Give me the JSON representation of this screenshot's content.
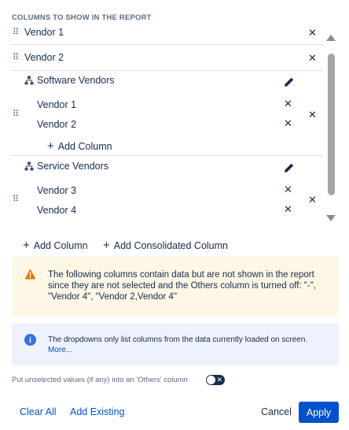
{
  "header": {
    "title": "COLUMNS TO SHOW IN THE REPORT"
  },
  "columns": {
    "rows": [
      {
        "label": "Vendor 1",
        "remove_glyph": "✕"
      },
      {
        "label": "Vendor 2",
        "remove_glyph": "✕"
      }
    ],
    "groups": [
      {
        "title": "Software Vendors",
        "icon": "hierarchy-icon",
        "edit_icon": "pencil-icon",
        "items": [
          {
            "label": "Vendor 1"
          },
          {
            "label": "Vendor 2"
          }
        ],
        "add_label": "Add Column"
      },
      {
        "title": "Service Vendors",
        "icon": "hierarchy-icon",
        "edit_icon": "pencil-icon",
        "items": [
          {
            "label": "Vendor 3"
          },
          {
            "label": "Vendor 4"
          }
        ]
      }
    ],
    "drag_glyph": "⠿",
    "remove_glyph": "✕"
  },
  "actions": {
    "plus_glyph": "+",
    "add_column": "Add Column",
    "add_consolidated": "Add Consolidated Column"
  },
  "warning": {
    "icon": "warning-icon",
    "text": "The following columns contain data but are not shown in the report since they are not selected and the Others column is turned off: \"-\", \"Vendor 4\", \"Vendor 2,Vendor 4\""
  },
  "info": {
    "icon": "info-icon",
    "text": "The dropdowns only list columns from the data currently loaded on screen.",
    "more": "More..."
  },
  "others_toggle": {
    "label": "Put unselected values (if any) into an 'Others' column",
    "on": false,
    "mark": "✕"
  },
  "footer": {
    "clear_all": "Clear All",
    "add_existing": "Add Existing",
    "cancel": "Cancel",
    "apply": "Apply"
  },
  "colors": {
    "accent": "#0052cc",
    "warning_bg": "#fff7e6",
    "warning_icon": "#e07b00",
    "info_bg": "#eef2fc",
    "info_icon": "#3572e0"
  }
}
